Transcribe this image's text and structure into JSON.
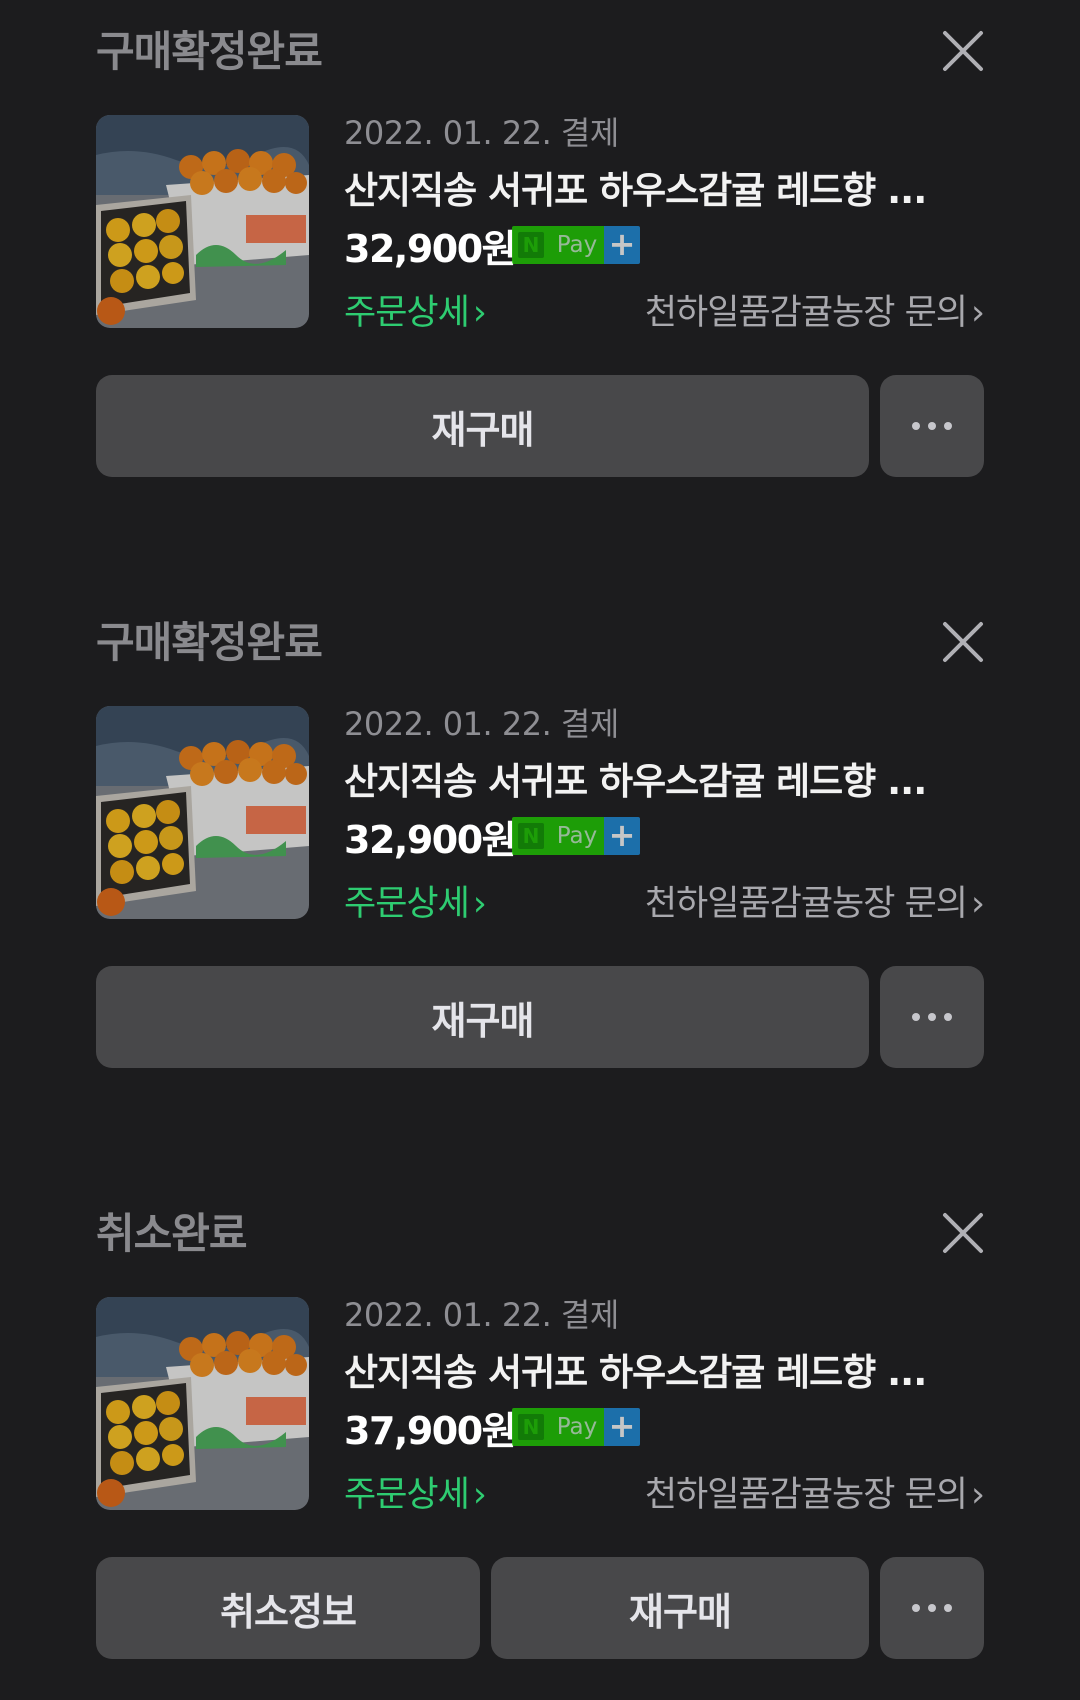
{
  "orders": [
    {
      "status": "구매확정완료",
      "date": "2022. 01. 22. 결제",
      "title": "산지직송 서귀포 하우스감귤 레드향 ...",
      "price": "32,900원",
      "detail_link": "주문상세",
      "seller_link": "천하일품감귤농장 문의",
      "buttons": {
        "rebuy": "재구매"
      }
    },
    {
      "status": "구매확정완료",
      "date": "2022. 01. 22. 결제",
      "title": "산지직송 서귀포 하우스감귤 레드향 ...",
      "price": "32,900원",
      "detail_link": "주문상세",
      "seller_link": "천하일품감귤농장 문의",
      "buttons": {
        "rebuy": "재구매"
      }
    },
    {
      "status": "취소완료",
      "date": "2022. 01. 22. 결제",
      "title": "산지직송 서귀포 하우스감귤 레드향 ...",
      "price": "37,900원",
      "detail_link": "주문상세",
      "seller_link": "천하일품감귤농장 문의",
      "buttons": {
        "cancel_info": "취소정보",
        "rebuy": "재구매"
      }
    }
  ],
  "badge": {
    "n_letter": "N",
    "pay_text": "Pay",
    "plus": "+"
  },
  "icons": {
    "close": "close-icon",
    "more": "more-dots-icon",
    "chevron": "chevron-right-icon"
  },
  "colors": {
    "background": "#1c1c1e",
    "status_text": "#8a8a8e",
    "detail_link": "#2ecc71",
    "button_bg": "#48484a",
    "npay_green": "#1ec800",
    "npay_blue": "#1d8bd9"
  }
}
